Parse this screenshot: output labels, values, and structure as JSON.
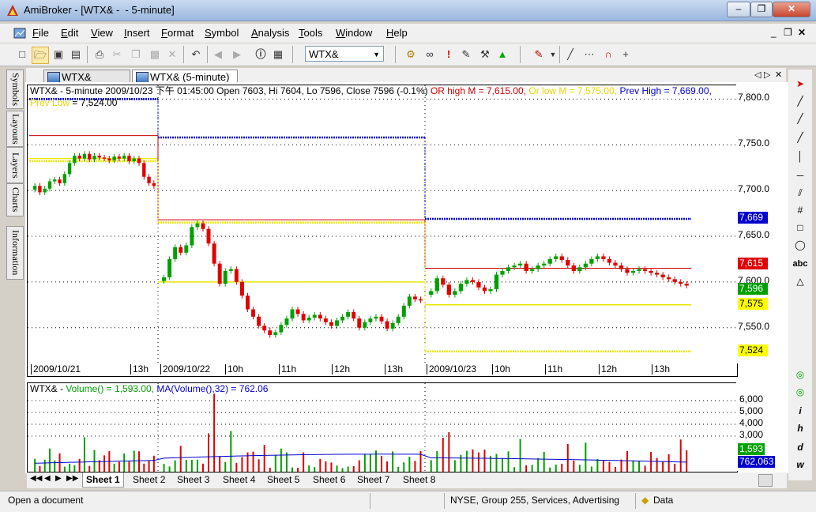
{
  "window": {
    "title": "AmiBroker - [WTX& -  - 5-minute]",
    "minimize": "–",
    "restore": "❐",
    "close": "✕"
  },
  "mdi": {
    "minimize": "_",
    "restore": "❐",
    "close": "✕"
  },
  "menu": [
    "File",
    "Edit",
    "View",
    "Insert",
    "Format",
    "Symbol",
    "Analysis",
    "Tools",
    "Window",
    "Help"
  ],
  "toolbar": {
    "symbol": "WTX&"
  },
  "side_tabs": [
    "Symbols",
    "Layouts",
    "Layers",
    "Charts",
    "Information"
  ],
  "chart_tabs": [
    {
      "label": "WTX& (Hourly)",
      "active": false
    },
    {
      "label": "WTX& (5-minute)",
      "active": true
    }
  ],
  "chart_nav": {
    "prev": "◁",
    "next": "▷",
    "close": "✕"
  },
  "price_header": {
    "main": "WTX& - 5-minute 2009/10/23 下午 01:45:00 Open 7603, Hi 7604, Lo 7596, Close 7596 (-0.1%) ",
    "or_high": "OR high M = 7,615.00, ",
    "or_low": "Or low M = 7,575.00, ",
    "prev_high": "Prev High = 7,669.00, ",
    "prev_low": "Prev Low",
    "prev_low_value": " = 7,524.00"
  },
  "vol_header": {
    "symbol": "WTX& - ",
    "volume": "Volume() = 1,593.00, ",
    "ma": "MA(Volume(),32) = 762.06"
  },
  "colors": {
    "up": "#00a000",
    "down": "#e00000",
    "or_high": "#cc0000",
    "or_low": "#e8e800",
    "prev_high": "#0000cc",
    "prev_low": "#e8e800",
    "ma": "#0000cc",
    "grid": "#000000"
  },
  "chart_data": {
    "type": "candlestick",
    "price_axis": {
      "ticks": [
        "7,800.0",
        "7,750.0",
        "7,700.0",
        "7,650.0",
        "7,600.0",
        "7,550.0"
      ],
      "ylim": [
        7510,
        7815
      ]
    },
    "date_axis": [
      "2009/10/21",
      "13h",
      "2009/10/22",
      "10h",
      "11h",
      "12h",
      "13h",
      "2009/10/23",
      "10h",
      "11h",
      "12h",
      "13h"
    ],
    "price_tags": [
      {
        "label": "7,669",
        "bg": "#0000cc",
        "fg": "#ffffff",
        "value": 7669
      },
      {
        "label": "7,615",
        "bg": "#e00000",
        "fg": "#ffffff",
        "value": 7615
      },
      {
        "label": "7,596",
        "bg": "#00a000",
        "fg": "#ffffff",
        "value": 7596
      },
      {
        "label": "7,575",
        "bg": "#ffff00",
        "fg": "#000000",
        "value": 7575
      },
      {
        "label": "7,524",
        "bg": "#ffff00",
        "fg": "#000000",
        "value": 7524
      }
    ],
    "sessions": [
      {
        "date": "2009/10/21",
        "or_high": 7760,
        "or_low": 7735,
        "prev_high": 7800,
        "prev_low": 7732
      },
      {
        "date": "2009/10/22",
        "or_high": 7668,
        "or_low": 7600,
        "prev_high": 7758,
        "prev_low": 7665
      },
      {
        "date": "2009/10/23",
        "or_high": 7615,
        "or_low": 7575,
        "prev_high": 7669,
        "prev_low": 7524
      }
    ],
    "candles": {
      "2009/10/21": [
        7705,
        7698,
        7702,
        7710,
        7712,
        7708,
        7718,
        7730,
        7738,
        7735,
        7740,
        7734,
        7738,
        7736,
        7735,
        7733,
        7737,
        7735,
        7738,
        7732,
        7735,
        7730,
        7715,
        7708,
        7705
      ],
      "2009/10/22": [
        7605,
        7625,
        7638,
        7632,
        7640,
        7660,
        7664,
        7658,
        7642,
        7620,
        7598,
        7612,
        7614,
        7600,
        7585,
        7570,
        7562,
        7552,
        7547,
        7542,
        7545,
        7553,
        7560,
        7570,
        7565,
        7558,
        7561,
        7564,
        7560,
        7556,
        7552,
        7558,
        7562,
        7567,
        7560,
        7550,
        7556,
        7560,
        7562,
        7557,
        7549,
        7555,
        7562,
        7574,
        7584,
        7581,
        7580
      ],
      "2009/10/23": [
        7590,
        7604,
        7597,
        7586,
        7590,
        7598,
        7602,
        7600,
        7594,
        7590,
        7592,
        7608,
        7612,
        7616,
        7618,
        7620,
        7612,
        7614,
        7618,
        7620,
        7625,
        7628,
        7624,
        7618,
        7612,
        7616,
        7620,
        7625,
        7628,
        7625,
        7621,
        7618,
        7614,
        7610,
        7612,
        7614,
        7612,
        7610,
        7608,
        7605,
        7603,
        7600,
        7598,
        7596
      ]
    },
    "volume_axis": {
      "ticks": [
        "6,000",
        "5,000",
        "4,000",
        "3,000"
      ],
      "ylim": [
        0,
        6400
      ]
    },
    "volume_tags": [
      {
        "label": "1,593",
        "bg": "#00a000",
        "fg": "#ffffff",
        "value": 1593
      },
      {
        "label": "762,063",
        "bg": "#0000cc",
        "fg": "#ffffff",
        "value": 762
      }
    ]
  },
  "sheets": [
    "Sheet 1",
    "Sheet 2",
    "Sheet 3",
    "Sheet 4",
    "Sheet 5",
    "Sheet 6",
    "Sheet 7",
    "Sheet 8"
  ],
  "status": {
    "message": "Open a document",
    "info": "NYSE, Group 255, Services, Advertising",
    "data": "Data"
  }
}
